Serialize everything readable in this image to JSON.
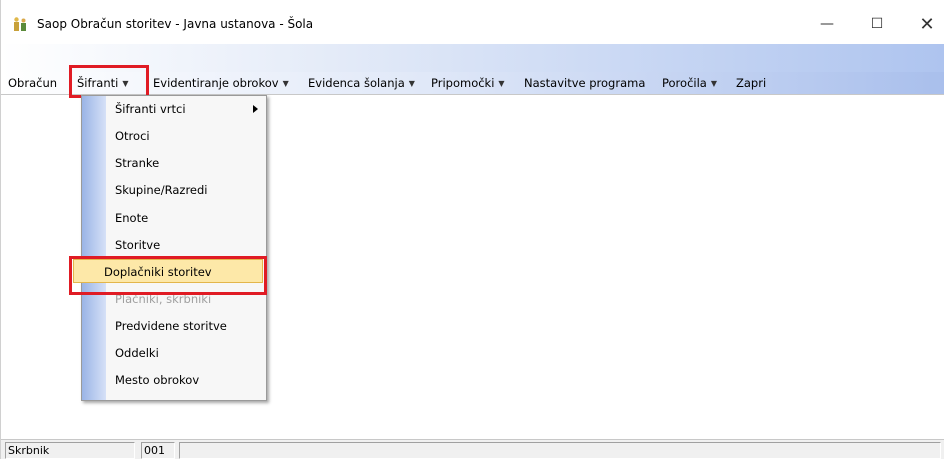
{
  "window": {
    "title": "Saop Obračun storitev - Javna ustanova - Šola",
    "controls": {
      "minimize": "—",
      "maximize": "☐",
      "close": "✕"
    }
  },
  "menubar": {
    "items": [
      {
        "label": "Obračun",
        "has_arrow": false
      },
      {
        "label": "Šifranti",
        "has_arrow": true
      },
      {
        "label": "Evidentiranje obrokov",
        "has_arrow": true
      },
      {
        "label": "Evidenca šolanja",
        "has_arrow": true
      },
      {
        "label": "Pripomočki",
        "has_arrow": true
      },
      {
        "label": "Nastavitve programa",
        "has_arrow": false
      },
      {
        "label": "Poročila",
        "has_arrow": true
      },
      {
        "label": "Zapri",
        "has_arrow": false
      }
    ],
    "arrow_glyph": "▼"
  },
  "dropdown": {
    "items": [
      {
        "label": "Šifranti vrtci",
        "state": "normal",
        "submenu": true
      },
      {
        "label": "Otroci",
        "state": "normal"
      },
      {
        "label": "Stranke",
        "state": "normal"
      },
      {
        "label": "Skupine/Razredi",
        "state": "normal"
      },
      {
        "label": "Enote",
        "state": "normal"
      },
      {
        "label": "Storitve",
        "state": "normal"
      },
      {
        "label": "Doplačniki storitev",
        "state": "selected"
      },
      {
        "label": "Plačniki, skrbniki",
        "state": "disabled"
      },
      {
        "label": "Predvidene storitve",
        "state": "normal"
      },
      {
        "label": "Oddelki",
        "state": "normal"
      },
      {
        "label": "Mesto obrokov",
        "state": "normal"
      }
    ]
  },
  "statusbar": {
    "cells": [
      "Skrbnik",
      "001",
      ""
    ]
  },
  "colors": {
    "highlight": "#e01b24",
    "selected_bg": "#fde8a8",
    "menubar_gradient_end": "#a9bfec"
  }
}
